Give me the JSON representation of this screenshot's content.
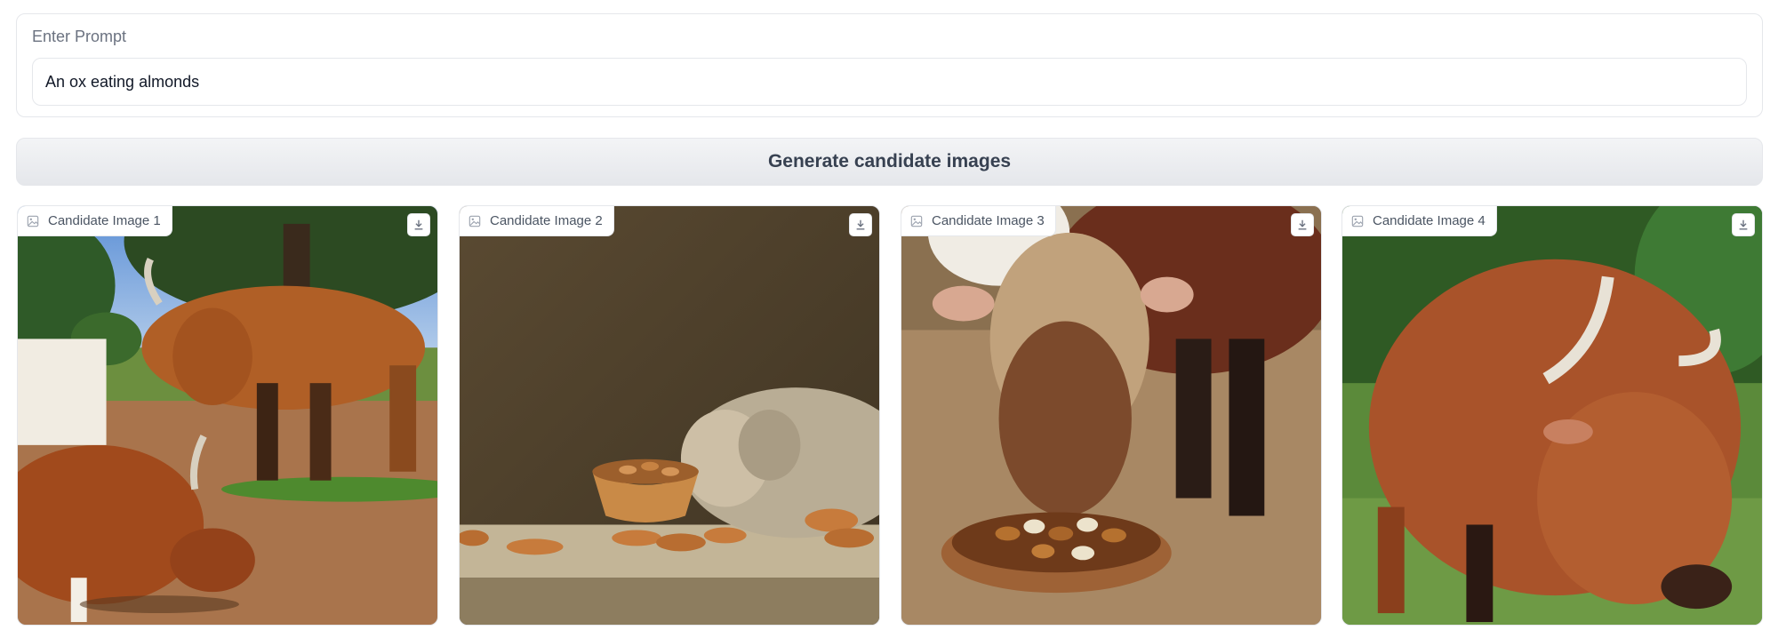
{
  "prompt": {
    "label": "Enter Prompt",
    "value": "An ox eating almonds"
  },
  "generate_button": {
    "label": "Generate candidate images"
  },
  "candidates": [
    {
      "label": "Candidate Image 1",
      "scene": "two oxen grazing on dirt field under trees"
    },
    {
      "label": "Candidate Image 2",
      "scene": "ox head by a bowl of almonds on a table"
    },
    {
      "label": "Candidate Image 3",
      "scene": "shaggy ox eating almonds from a plate"
    },
    {
      "label": "Candidate Image 4",
      "scene": "brown horned ox grazing in grass"
    }
  ],
  "icons": {
    "image": "image-icon",
    "download": "download-icon"
  }
}
